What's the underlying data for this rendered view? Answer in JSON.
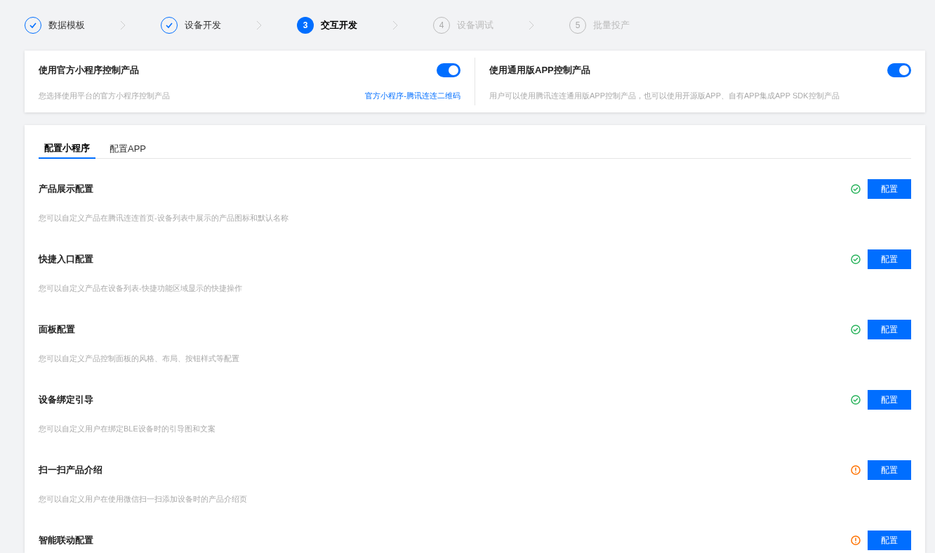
{
  "steps": [
    {
      "label": "数据模板",
      "done": true,
      "selected": false
    },
    {
      "label": "设备开发",
      "done": true,
      "selected": false
    },
    {
      "number": "3",
      "label": "交互开发",
      "done": false,
      "selected": true
    },
    {
      "number": "4",
      "label": "设备调试",
      "done": false,
      "selected": false
    },
    {
      "number": "5",
      "label": "批量投产",
      "done": false,
      "selected": false
    }
  ],
  "control_options": [
    {
      "title": "使用官方小程序控制产品",
      "on": true,
      "description": "您选择使用平台的官方小程序控制产品",
      "link": "官方小程序-腾讯连连二维码"
    },
    {
      "title": "使用通用版APP控制产品",
      "on": true,
      "description": "用户可以使用腾讯连连通用版APP控制产品，也可以使用开源版APP、自有APP集成APP SDK控制产品"
    }
  ],
  "tabs": [
    {
      "label": "配置小程序",
      "selected": true
    },
    {
      "label": "配置APP",
      "selected": false
    }
  ],
  "config_items": [
    {
      "title": "产品展示配置",
      "description": "您可以自定义产品在腾讯连连首页-设备列表中展示的产品图标和默认名称",
      "complete": true,
      "button": "配置"
    },
    {
      "title": "快捷入口配置",
      "description": "您可以自定义产品在设备列表-快捷功能区域显示的快捷操作",
      "complete": true,
      "button": "配置"
    },
    {
      "title": "面板配置",
      "description": "您可以自定义产品控制面板的风格、布局、按钮样式等配置",
      "complete": true,
      "button": "配置"
    },
    {
      "title": "设备绑定引导",
      "description": "您可以自定义用户在绑定BLE设备时的引导图和文案",
      "complete": true,
      "button": "配置"
    },
    {
      "title": "扫一扫产品介绍",
      "description": "您可以自定义用户在使用微信扫一扫添加设备时的产品介绍页",
      "complete": false,
      "button": "配置"
    },
    {
      "title": "智能联动配置",
      "complete": false,
      "button": "配置"
    }
  ]
}
